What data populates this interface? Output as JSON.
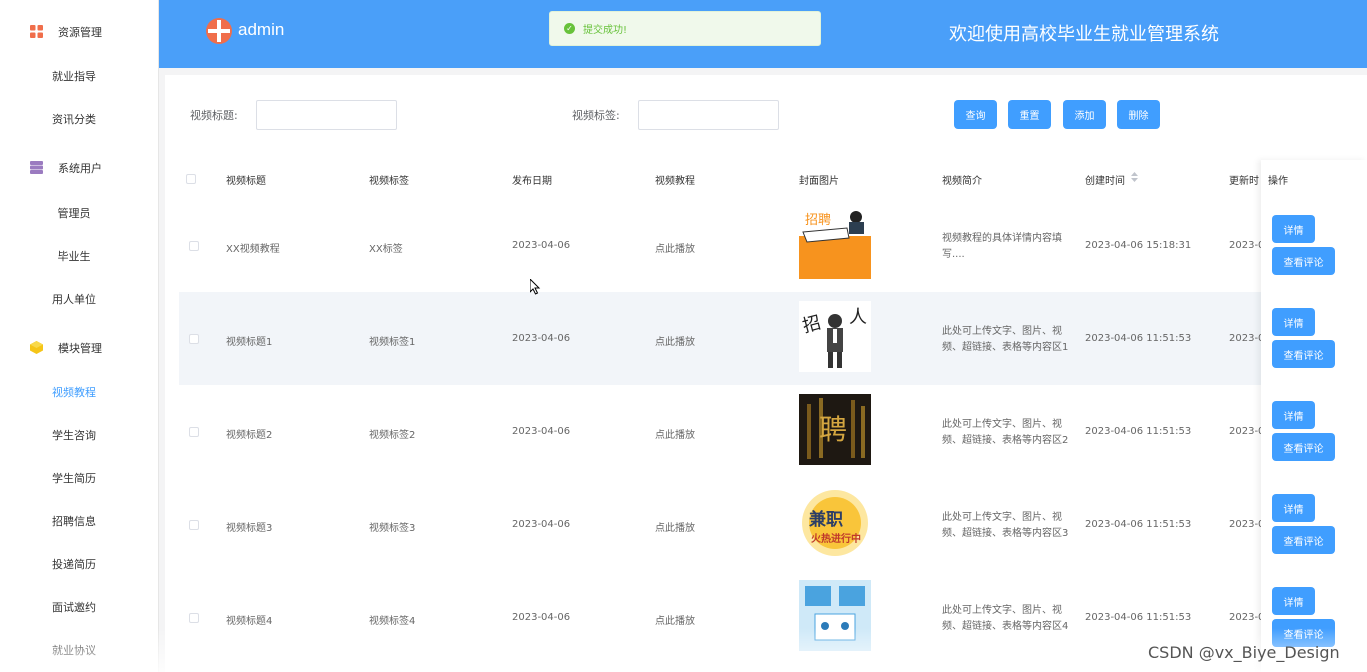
{
  "sidebar": {
    "groups": [
      {
        "label": "资源管理",
        "icon": "grid-icon",
        "color": "#f06e4b"
      },
      {
        "label": "系统用户",
        "icon": "database-icon",
        "color": "#9b7bc0"
      },
      {
        "label": "模块管理",
        "icon": "cube-icon",
        "color": "#f5c518"
      }
    ],
    "items": [
      "就业指导",
      "资讯分类",
      "管理员",
      "毕业生",
      "用人单位",
      "视频教程",
      "学生咨询",
      "学生简历",
      "招聘信息",
      "投递简历",
      "面试邀约",
      "就业协议"
    ],
    "active_item": "视频教程"
  },
  "header": {
    "admin": "admin",
    "title": "欢迎使用高校毕业生就业管理系统",
    "toast": "提交成功!"
  },
  "search": {
    "title_label": "视频标题:",
    "tag_label": "视频标签:",
    "title_value": "",
    "tag_value": "",
    "query": "查询",
    "reset": "重置",
    "add": "添加",
    "delete": "删除"
  },
  "table": {
    "columns": [
      "视频标题",
      "视频标签",
      "发布日期",
      "视频教程",
      "封面图片",
      "视频简介",
      "创建时间",
      "更新时",
      "操作"
    ],
    "rows": [
      {
        "title": "XX视频教程",
        "tag": "XX标签",
        "date": "2023-04-06",
        "video": "点此播放",
        "intro": "视频教程的具体详情内容填写....",
        "created": "2023-04-06 15:18:31",
        "updated": "2023-0"
      },
      {
        "title": "视频标题1",
        "tag": "视频标签1",
        "date": "2023-04-06",
        "video": "点此播放",
        "intro": "此处可上传文字、图片、视频、超链接、表格等内容区1",
        "created": "2023-04-06 11:51:53",
        "updated": "2023-0"
      },
      {
        "title": "视频标题2",
        "tag": "视频标签2",
        "date": "2023-04-06",
        "video": "点此播放",
        "intro": "此处可上传文字、图片、视频、超链接、表格等内容区2",
        "created": "2023-04-06 11:51:53",
        "updated": "2023-0"
      },
      {
        "title": "视频标题3",
        "tag": "视频标签3",
        "date": "2023-04-06",
        "video": "点此播放",
        "intro": "此处可上传文字、图片、视频、超链接、表格等内容区3",
        "created": "2023-04-06 11:51:53",
        "updated": "2023-0"
      },
      {
        "title": "视频标题4",
        "tag": "视频标签4",
        "date": "2023-04-06",
        "video": "点此播放",
        "intro": "此处可上传文字、图片、视频、超链接、表格等内容区4",
        "created": "2023-04-06 11:51:53",
        "updated": "2023-0"
      }
    ],
    "detail_label": "详情",
    "comment_label": "查看评论"
  },
  "watermark": "CSDN @vx_Biye_Design",
  "colors": {
    "primary": "#409eff",
    "header": "#4a9ff9",
    "success": "#67c23a"
  }
}
